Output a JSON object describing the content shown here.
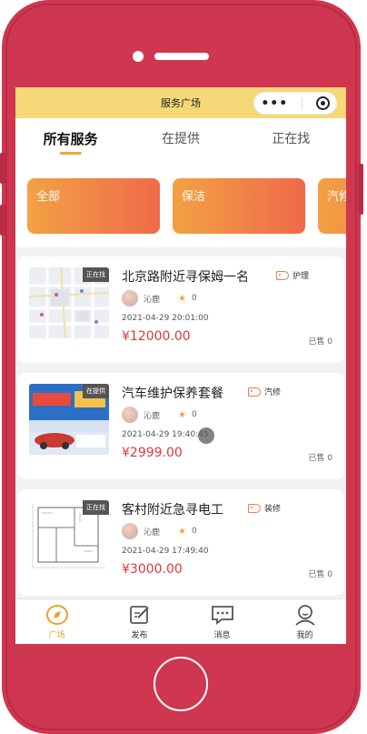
{
  "nav": {
    "title": "服务广场",
    "capsule_dots": "•••"
  },
  "tabs": [
    "所有服务",
    "在提供",
    "正在找"
  ],
  "categories": [
    "全部",
    "保洁",
    "汽修"
  ],
  "services": [
    {
      "title": "北京路附近寻保姆一名",
      "tag": "护理",
      "thumb_tag": "正在找",
      "user": "沁鹿",
      "score": "0",
      "time": "2021-04-29 20:01:00",
      "price": "¥12000.00",
      "sold": "已售 0"
    },
    {
      "title": "汽车维护保养套餐",
      "tag": "汽修",
      "thumb_tag": "在提供",
      "user": "沁鹿",
      "score": "0",
      "time": "2021-04-29 19:40:45",
      "price": "¥2999.00",
      "sold": "已售 0"
    },
    {
      "title": "客村附近急寻电工",
      "tag": "装修",
      "thumb_tag": "正在找",
      "user": "沁鹿",
      "score": "0",
      "time": "2021-04-29 17:49:40",
      "price": "¥3000.00",
      "sold": "已售 0"
    }
  ],
  "tabbar": [
    {
      "label": "广场",
      "icon": "compass-icon",
      "active": true
    },
    {
      "label": "发布",
      "icon": "edit-icon",
      "active": false
    },
    {
      "label": "消息",
      "icon": "message-icon",
      "active": false
    },
    {
      "label": "我的",
      "icon": "user-icon",
      "active": false
    }
  ],
  "colors": {
    "frame": "#cf3650",
    "nav": "#f6d878",
    "accent": "#f0a43a",
    "price": "#e2363a"
  }
}
